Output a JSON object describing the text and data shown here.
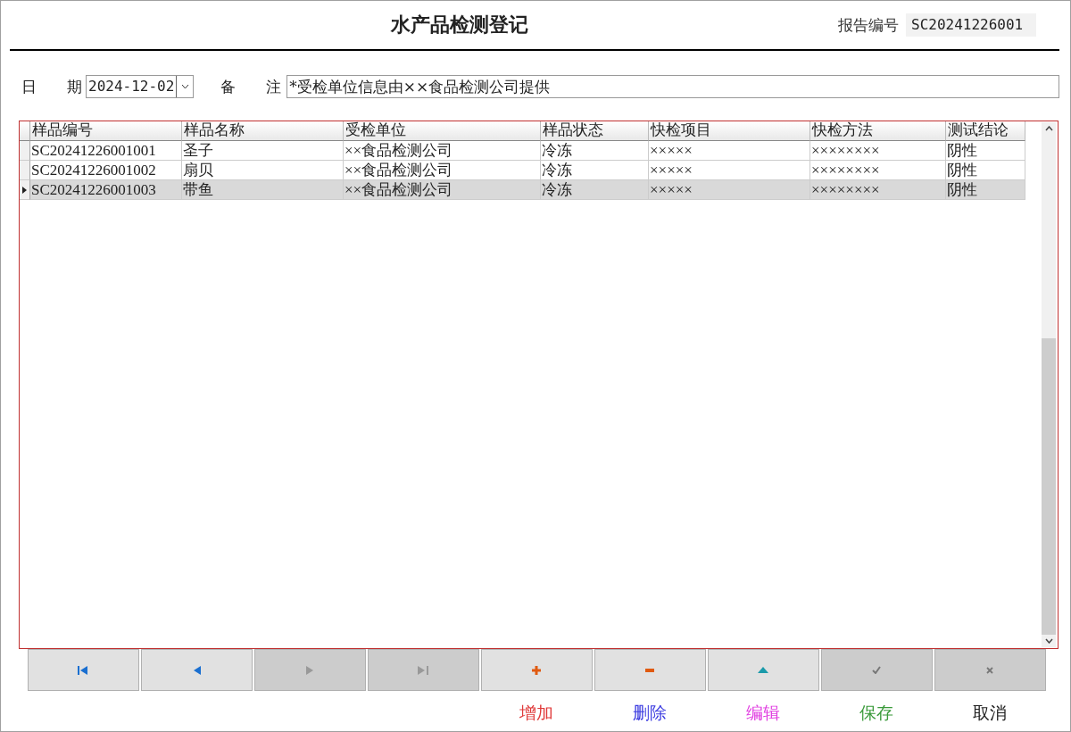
{
  "title": "水产品检测登记",
  "report_no": {
    "label": "报告编号",
    "value": "SC20241226001"
  },
  "date": {
    "label": "日　　期",
    "value": "2024-12-02"
  },
  "remark": {
    "label": "备　　注",
    "value": "*受检单位信息由××食品检测公司提供"
  },
  "table": {
    "columns": [
      "样品编号",
      "样品名称",
      "受检单位",
      "样品状态",
      "快检项目",
      "快检方法",
      "测试结论"
    ],
    "rows": [
      {
        "cells": [
          "SC20241226001001",
          "圣子",
          "××食品检测公司",
          "冷冻",
          "×××××",
          "××××××××",
          "阴性"
        ],
        "selected": false
      },
      {
        "cells": [
          "SC20241226001002",
          "扇贝",
          "××食品检测公司",
          "冷冻",
          "×××××",
          "××××××××",
          "阴性"
        ],
        "selected": false
      },
      {
        "cells": [
          "SC20241226001003",
          "带鱼",
          "××食品检测公司",
          "冷冻",
          "×××××",
          "××××××××",
          "阴性"
        ],
        "selected": true
      }
    ]
  },
  "buttons": [
    {
      "kind": "first",
      "disabled": false
    },
    {
      "kind": "prev",
      "disabled": false
    },
    {
      "kind": "next",
      "disabled": true
    },
    {
      "kind": "last",
      "disabled": true
    },
    {
      "kind": "add",
      "disabled": false,
      "caption": "增加",
      "color": "#e03a3a"
    },
    {
      "kind": "delete",
      "disabled": false,
      "caption": "删除",
      "color": "#3a3ae0"
    },
    {
      "kind": "edit",
      "disabled": false,
      "caption": "编辑",
      "color": "#e03ae0"
    },
    {
      "kind": "save",
      "disabled": true,
      "caption": "保存",
      "color": "#3a9a3a"
    },
    {
      "kind": "cancel",
      "disabled": true,
      "caption": "取消",
      "color": "#202020"
    }
  ]
}
